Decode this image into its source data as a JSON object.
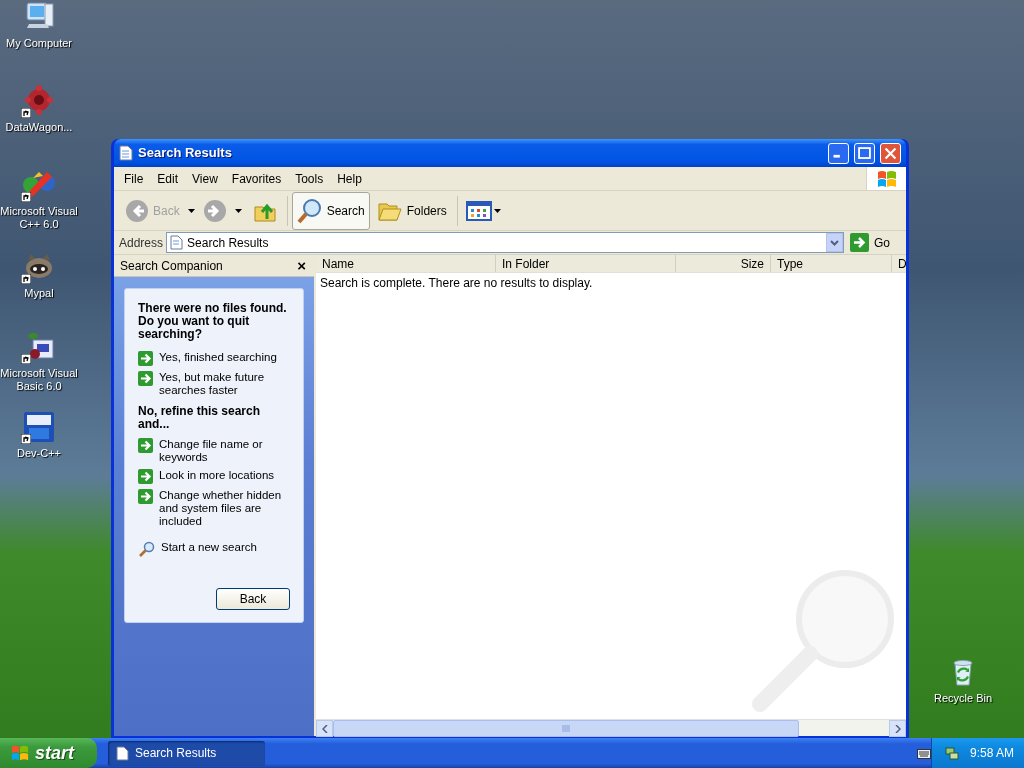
{
  "desktop_icons": [
    {
      "kind": "computer",
      "label": "My Computer",
      "shortcut": false
    },
    {
      "kind": "gear",
      "label": "DataWagon...",
      "shortcut": true
    },
    {
      "kind": "cpp",
      "label": "Microsoft Visual C++ 6.0",
      "shortcut": true
    },
    {
      "kind": "raccoon",
      "label": "Mypal",
      "shortcut": true
    },
    {
      "kind": "vb",
      "label": "Microsoft Visual Basic 6.0",
      "shortcut": true
    },
    {
      "kind": "dev",
      "label": "Dev-C++",
      "shortcut": true
    },
    {
      "kind": "recycle",
      "label": "Recycle Bin",
      "shortcut": false
    }
  ],
  "window": {
    "title": "Search Results",
    "menu": [
      "File",
      "Edit",
      "View",
      "Favorites",
      "Tools",
      "Help"
    ],
    "toolbar": [
      {
        "kind": "back",
        "label": "Back",
        "disabled": true
      },
      {
        "kind": "forward",
        "disabled": true
      },
      {
        "kind": "up",
        "disabled": false
      },
      {
        "kind": "search",
        "label": "Search",
        "selected": true
      },
      {
        "kind": "folders",
        "label": "Folders",
        "selected": false
      },
      {
        "kind": "views"
      }
    ],
    "address": {
      "label": "Address",
      "value": "Search Results",
      "go": "Go"
    },
    "search_companion": {
      "title": "Search Companion",
      "close": "×",
      "heading": "There were no files found. Do you want to quit searching?",
      "links": [
        {
          "kind": "arrow",
          "text": "Yes, finished searching"
        },
        {
          "kind": "arrow",
          "text": "Yes, but make future searches faster"
        },
        {
          "kind": "heading",
          "text": "No, refine this search and..."
        },
        {
          "kind": "arrow",
          "text": "Change file name or keywords"
        },
        {
          "kind": "arrow",
          "text": "Look in more locations"
        },
        {
          "kind": "arrow",
          "text": "Change whether hidden and system files are included"
        },
        {
          "kind": "search",
          "text": "Start a new search"
        }
      ],
      "button": "Back"
    },
    "columns": [
      {
        "label": "Name"
      },
      {
        "label": "In Folder"
      },
      {
        "label": "Size"
      },
      {
        "label": "Type"
      },
      {
        "label": "D"
      }
    ],
    "message": "Search is complete. There are no results to display."
  },
  "taskbar": {
    "start": "start",
    "tasks": [
      {
        "label": "Search Results",
        "selected": true
      }
    ],
    "clock": "9:58 AM"
  }
}
